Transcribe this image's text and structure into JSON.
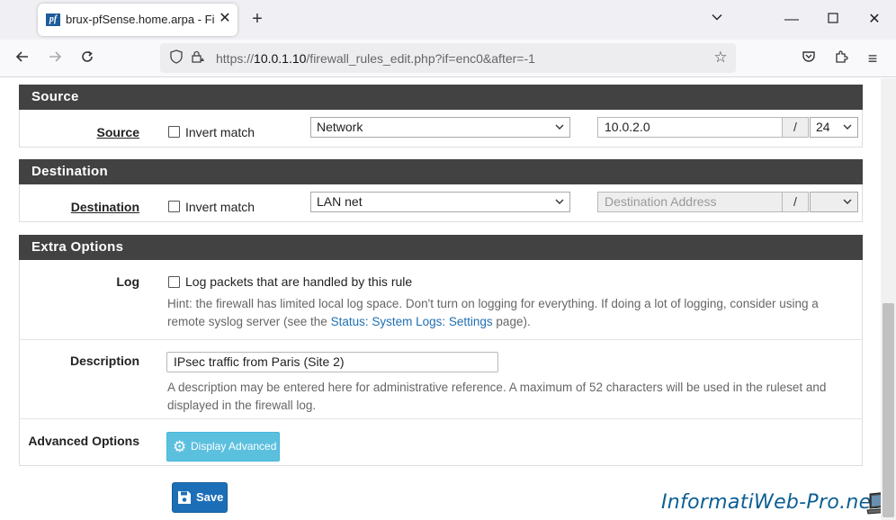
{
  "browser": {
    "tab_title": "brux-pfSense.home.arpa - Firewall: Rules: Edit",
    "tab_favicon": "pf",
    "url_scheme": "https://",
    "url_host": "10.0.1.10",
    "url_path": "/firewall_rules_edit.php?if=enc0&after=-1"
  },
  "source": {
    "section_title": "Source",
    "label": "Source",
    "invert_label": "Invert match",
    "invert_checked": false,
    "type_value": "Network",
    "address_value": "10.0.2.0",
    "slash": "/",
    "mask_value": "24"
  },
  "destination": {
    "section_title": "Destination",
    "label": "Destination",
    "invert_label": "Invert match",
    "invert_checked": false,
    "type_value": "LAN net",
    "address_placeholder": "Destination Address",
    "slash": "/",
    "mask_value": ""
  },
  "extra": {
    "section_title": "Extra Options",
    "log_label": "Log",
    "log_checkbox_label": "Log packets that are handled by this rule",
    "log_checked": false,
    "log_hint_line1": "Hint: the firewall has limited local log space. Don't turn on logging for everything. If doing a lot of logging, consider using a",
    "log_hint_line2_pre": "remote syslog server (see the ",
    "log_hint_link": "Status: System Logs: Settings",
    "log_hint_line2_post": " page).",
    "description_label": "Description",
    "description_value": "IPsec traffic from Paris (Site 2)",
    "description_hint_line1": "A description may be entered here for administrative reference. A maximum of 52 characters will be used in the ruleset and",
    "description_hint_line2": "displayed in the firewall log.",
    "advanced_label": "Advanced Options",
    "advanced_button": "Display Advanced"
  },
  "save_button": "Save",
  "watermark": "InformatiWeb-Pro.net",
  "colors": {
    "panel_header": "#424242",
    "info_button": "#5bc0de",
    "primary_button": "#1c6fb7",
    "link": "#1f6fb2"
  }
}
